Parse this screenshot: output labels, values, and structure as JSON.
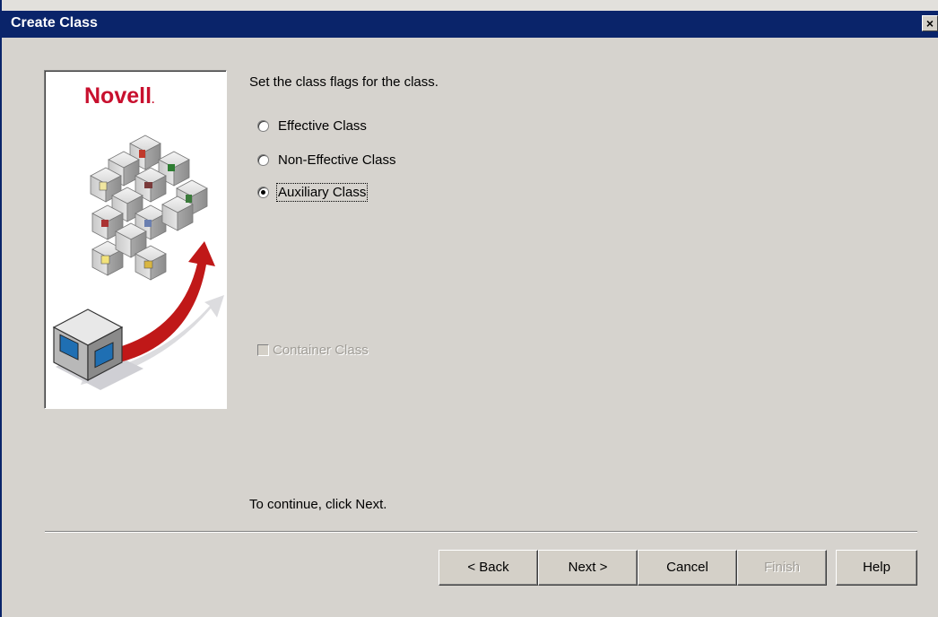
{
  "window": {
    "title": "Create Class",
    "close_glyph": "×"
  },
  "logo": {
    "brand": "Novell",
    "mark": "."
  },
  "instructions": {
    "heading": "Set the class flags for the class.",
    "footer": "To continue, click Next."
  },
  "class_options": [
    {
      "label": "Effective Class",
      "checked": false
    },
    {
      "label": "Non-Effective Class",
      "checked": false
    },
    {
      "label": "Auxiliary Class",
      "checked": true
    }
  ],
  "container_option": {
    "label": "Container Class",
    "checked": false,
    "enabled": false
  },
  "buttons": {
    "back": "< Back",
    "next": "Next >",
    "cancel": "Cancel",
    "finish": "Finish",
    "help": "Help"
  },
  "colors": {
    "title_bar": "#0a246a",
    "dialog_bg": "#d6d3ce",
    "brand_red": "#c8102e"
  },
  "icons": {
    "illustration": "network-cubes-server-illustration",
    "close": "close-icon"
  }
}
